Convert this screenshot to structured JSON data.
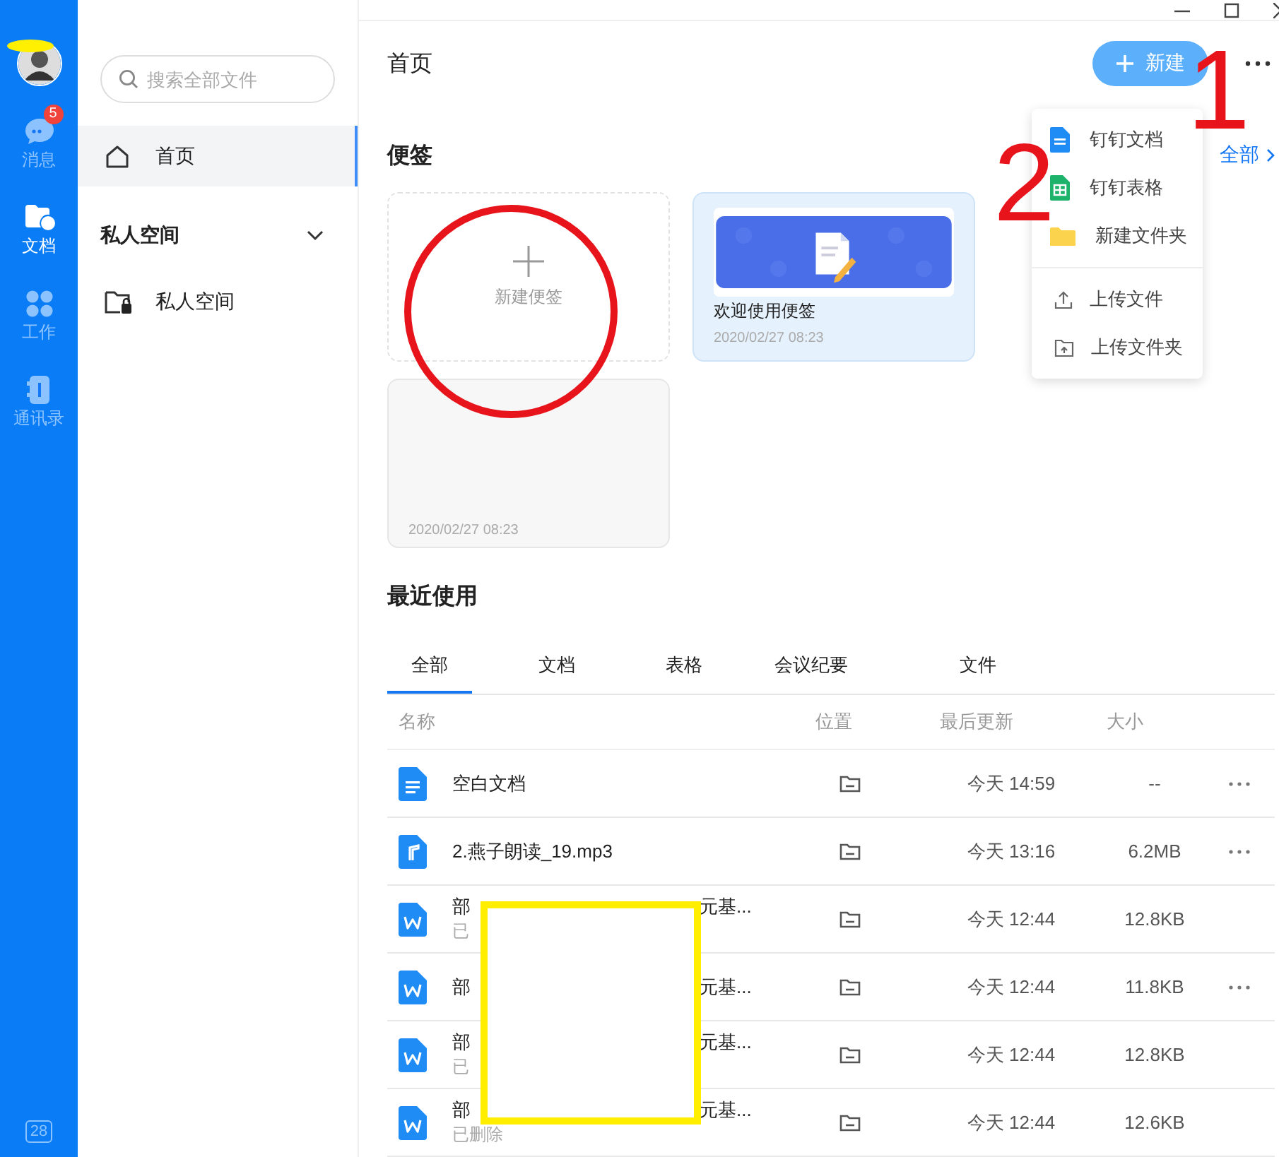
{
  "nav_rail": {
    "items": [
      {
        "kind": "chat",
        "label": "消息",
        "badge": "5",
        "selected": false
      },
      {
        "kind": "docs",
        "label": "文档",
        "selected": true
      },
      {
        "kind": "work",
        "label": "工作",
        "selected": false
      },
      {
        "kind": "contacts",
        "label": "通讯录",
        "selected": false
      }
    ],
    "calendar_day": "28"
  },
  "sidebar": {
    "search": {
      "placeholder": "搜索全部文件"
    },
    "items": [
      {
        "label": "首页",
        "selected": true
      }
    ],
    "section": {
      "title": "私人空间",
      "expanded": true,
      "items": [
        {
          "label": "私人空间"
        }
      ]
    }
  },
  "header": {
    "title": "首页",
    "new_button": "新建"
  },
  "notes": {
    "title": "便签",
    "view_all": "全部",
    "cards": [
      {
        "kind": "new",
        "label": "新建便签"
      },
      {
        "kind": "note",
        "title": "欢迎使用便签",
        "date": "2020/02/27 08:23"
      },
      {
        "kind": "blank",
        "date": "2020/02/27 08:23"
      }
    ]
  },
  "recent": {
    "title": "最近使用",
    "tabs": [
      {
        "label": "全部",
        "selected": true
      },
      {
        "label": "文档",
        "selected": false
      },
      {
        "label": "表格",
        "selected": false
      },
      {
        "label": "会议纪要",
        "selected": false
      },
      {
        "label": "文件",
        "selected": false
      }
    ],
    "table": {
      "columns": [
        "名称",
        "位置",
        "最后更新",
        "大小"
      ],
      "rows": [
        {
          "kind": "doc",
          "name": "空白文档",
          "updated": "今天 14:59",
          "size": "--",
          "more": true
        },
        {
          "kind": "audio",
          "name": "2.燕子朗读_19.mp3",
          "updated": "今天 13:16",
          "size": "6.2MB",
          "more": true
        },
        {
          "kind": "word",
          "name": "部",
          "name_end": "元基...",
          "note": "已",
          "updated": "今天 12:44",
          "size": "12.8KB",
          "more": false
        },
        {
          "kind": "word",
          "name": "部",
          "name_end": "元基...",
          "updated": "今天 12:44",
          "size": "11.8KB",
          "more": true
        },
        {
          "kind": "word",
          "name": "部",
          "name_end": "元基...",
          "note": "已",
          "updated": "今天 12:44",
          "size": "12.8KB",
          "more": false
        },
        {
          "kind": "word",
          "name": "部",
          "name_end": "元基...",
          "note": "已删除",
          "updated": "今天 12:44",
          "size": "12.6KB",
          "more": false
        }
      ]
    }
  },
  "new_menu": {
    "groups": [
      [
        {
          "kind": "doc",
          "label": "钉钉文档"
        },
        {
          "kind": "sheet",
          "label": "钉钉表格"
        },
        {
          "kind": "folder",
          "label": "新建文件夹"
        }
      ],
      [
        {
          "kind": "upload-file",
          "label": "上传文件"
        },
        {
          "kind": "upload-folder",
          "label": "上传文件夹"
        }
      ]
    ]
  },
  "annotations": [
    {
      "kind": "number",
      "text": "1"
    },
    {
      "kind": "number",
      "text": "2"
    }
  ]
}
